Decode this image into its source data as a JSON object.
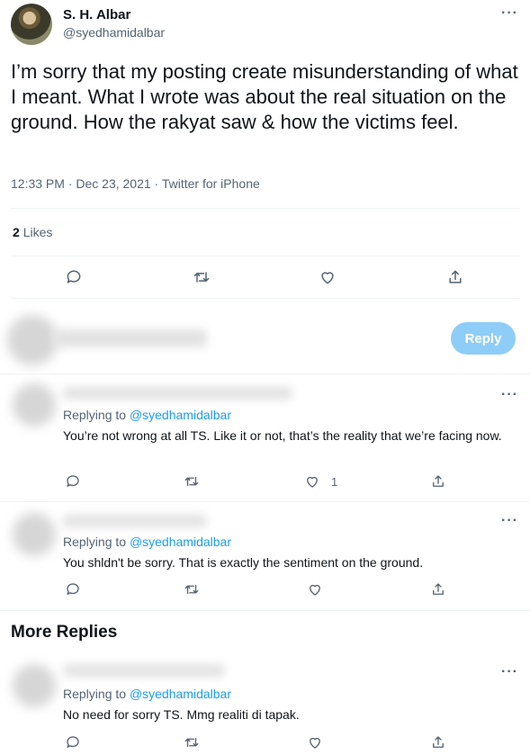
{
  "tweet": {
    "author_name": "S. H. Albar",
    "author_handle": "@syedhamidalbar",
    "text": "I’m sorry that my posting create misunderstanding of what I meant. What I wrote was about the real situation on the ground. How the rakyat saw & how the victims feel.",
    "timestamp": "12:33 PM · Dec 23, 2021 · Twitter for iPhone",
    "likes_count": "2",
    "likes_label": "Likes",
    "more_label": "···"
  },
  "compose": {
    "reply_button_label": "Reply"
  },
  "replies": [
    {
      "replying_prefix": "Replying to",
      "mention": "@syedhamidalbar",
      "text": "You’re not wrong at all TS. Like it or not, that’s the reality that we’re facing now.",
      "like_count": "1"
    },
    {
      "replying_prefix": "Replying to",
      "mention": "@syedhamidalbar",
      "text": "You shldn't be sorry. That is exactly the sentiment on the ground.",
      "like_count": ""
    }
  ],
  "more_replies": {
    "title": "More Replies",
    "items": [
      {
        "replying_prefix": "Replying to",
        "mention": "@syedhamidalbar",
        "text": "No need for sorry TS. Mmg realiti di tapak.",
        "like_count": ""
      }
    ]
  },
  "icons": {
    "reply": "reply-icon",
    "retweet": "retweet-icon",
    "like": "heart-icon",
    "share": "share-icon",
    "more": "more-icon"
  },
  "colors": {
    "accent": "#1d9bf0",
    "reply_button": "#8ecdf7",
    "secondary_text": "#536471"
  }
}
